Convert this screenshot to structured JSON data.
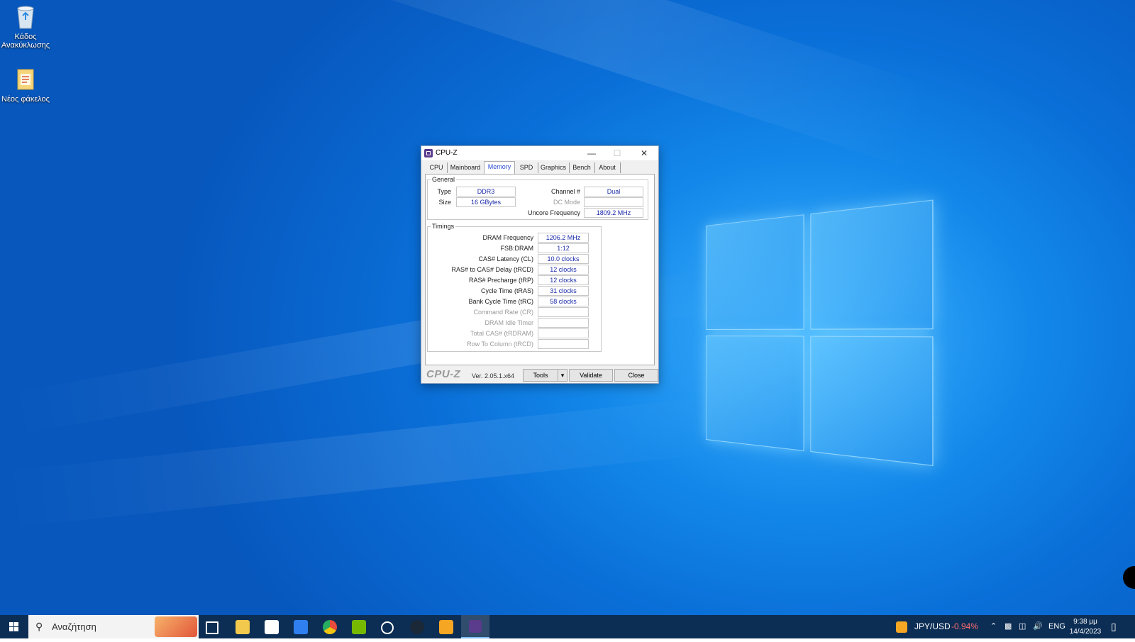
{
  "desktop": {
    "icons": [
      {
        "label_line1": "Κάδος",
        "label_line2": "Ανακύκλωσης",
        "icon": "recycle-bin-icon"
      },
      {
        "label_line1": "Νέος φάκελος",
        "label_line2": "",
        "icon": "folder-icon"
      }
    ]
  },
  "window": {
    "title": "CPU-Z",
    "tabs": [
      "CPU",
      "Mainboard",
      "Memory",
      "SPD",
      "Graphics",
      "Bench",
      "About"
    ],
    "active_tab": "Memory",
    "general": {
      "legend": "General",
      "type_label": "Type",
      "type_value": "DDR3",
      "size_label": "Size",
      "size_value": "16 GBytes",
      "channel_label": "Channel #",
      "channel_value": "Dual",
      "dcmode_label": "DC Mode",
      "dcmode_value": "",
      "uncore_label": "Uncore Frequency",
      "uncore_value": "1809.2 MHz"
    },
    "timings": {
      "legend": "Timings",
      "rows": [
        {
          "label": "DRAM Frequency",
          "value": "1206.2 MHz",
          "enabled": true
        },
        {
          "label": "FSB:DRAM",
          "value": "1:12",
          "enabled": true
        },
        {
          "label": "CAS# Latency (CL)",
          "value": "10.0 clocks",
          "enabled": true
        },
        {
          "label": "RAS# to CAS# Delay (tRCD)",
          "value": "12 clocks",
          "enabled": true
        },
        {
          "label": "RAS# Precharge (tRP)",
          "value": "12 clocks",
          "enabled": true
        },
        {
          "label": "Cycle Time (tRAS)",
          "value": "31 clocks",
          "enabled": true
        },
        {
          "label": "Bank Cycle Time (tRC)",
          "value": "58 clocks",
          "enabled": true
        },
        {
          "label": "Command Rate (CR)",
          "value": "",
          "enabled": false
        },
        {
          "label": "DRAM Idle Timer",
          "value": "",
          "enabled": false
        },
        {
          "label": "Total CAS# (tRDRAM)",
          "value": "",
          "enabled": false
        },
        {
          "label": "Row To Column (tRCD)",
          "value": "",
          "enabled": false
        }
      ]
    },
    "footer": {
      "brand": "CPU-Z",
      "version": "Ver. 2.05.1.x64",
      "tools_label": "Tools",
      "validate_label": "Validate",
      "close_label": "Close"
    }
  },
  "taskbar": {
    "search_placeholder": "Αναζήτηση",
    "ticker_symbol": "JPY/USD",
    "ticker_change": "-0.94%",
    "language": "ENG",
    "time": "9:38 μμ",
    "date": "14/4/2023",
    "colors": {
      "ticker_negative": "#ff6b6b",
      "taskbar_bg": "#0c2e55"
    }
  }
}
